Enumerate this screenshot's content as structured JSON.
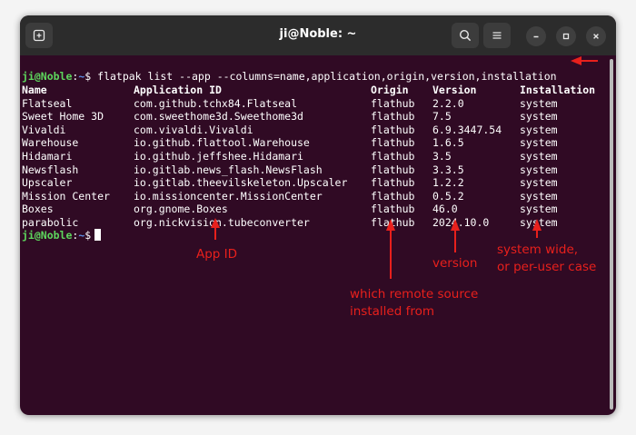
{
  "window": {
    "title": "ji@Noble: ~"
  },
  "prompt": {
    "user": "ji@Noble",
    "sep": ":",
    "path": "~",
    "symbol": "$"
  },
  "command": "flatpak list --app --columns=name,application,origin,version,installation",
  "table": {
    "headers": [
      "Name",
      "Application ID",
      "Origin",
      "Version",
      "Installation"
    ],
    "rows": [
      [
        "Flatseal",
        "com.github.tchx84.Flatseal",
        "flathub",
        "2.2.0",
        "system"
      ],
      [
        "Sweet Home 3D",
        "com.sweethome3d.Sweethome3d",
        "flathub",
        "7.5",
        "system"
      ],
      [
        "Vivaldi",
        "com.vivaldi.Vivaldi",
        "flathub",
        "6.9.3447.54",
        "system"
      ],
      [
        "Warehouse",
        "io.github.flattool.Warehouse",
        "flathub",
        "1.6.5",
        "system"
      ],
      [
        "Hidamari",
        "io.github.jeffshee.Hidamari",
        "flathub",
        "3.5",
        "system"
      ],
      [
        "Newsflash",
        "io.gitlab.news_flash.NewsFlash",
        "flathub",
        "3.3.5",
        "system"
      ],
      [
        "Upscaler",
        "io.gitlab.theevilskeleton.Upscaler",
        "flathub",
        "1.2.2",
        "system"
      ],
      [
        "Mission Center",
        "io.missioncenter.MissionCenter",
        "flathub",
        "0.5.2",
        "system"
      ],
      [
        "Boxes",
        "org.gnome.Boxes",
        "flathub",
        "46.0",
        "system"
      ],
      [
        "parabolic",
        "org.nickvision.tubeconverter",
        "flathub",
        "2024.10.0",
        "system"
      ]
    ]
  },
  "annotations": {
    "app_id": "App ID",
    "remote": [
      "which remote source",
      "installed from"
    ],
    "version": "version",
    "install": [
      "system wide,",
      "or per-user case"
    ]
  },
  "colors": {
    "terminal_bg": "#300a24",
    "prompt_user": "#5dd75d",
    "prompt_path": "#5b8ee6",
    "annotation": "#e8201c"
  },
  "icons": {
    "new_tab": "new-tab-icon",
    "search": "search-icon",
    "menu": "hamburger-menu-icon",
    "minimize": "minimize-icon",
    "maximize": "maximize-icon",
    "close": "close-icon"
  }
}
